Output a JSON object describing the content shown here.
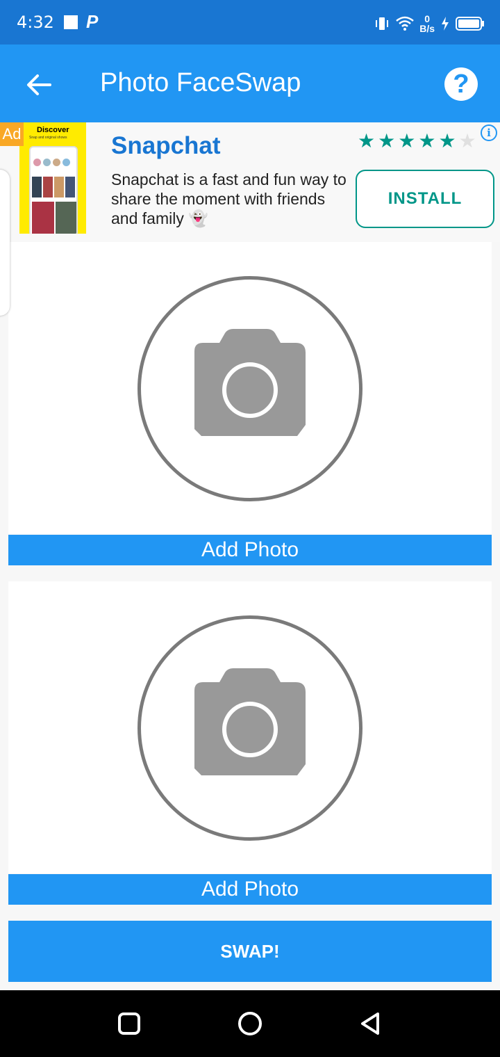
{
  "status_bar": {
    "time": "4:32",
    "net_speed_value": "0",
    "net_speed_unit": "B/s"
  },
  "app_bar": {
    "title": "Photo FaceSwap"
  },
  "ad": {
    "badge": "Ad",
    "image_title": "Discover",
    "image_subtitle": "Snap and original shows",
    "title": "Snapchat",
    "description": "Snapchat is a fast and fun way to share the moment with friends and family 👻",
    "rating_filled_stars": 5,
    "rating_total_stars": 6,
    "install_label": "INSTALL"
  },
  "photo_slots": [
    {
      "button_label": "Add Photo"
    },
    {
      "button_label": "Add Photo"
    }
  ],
  "swap_label": "SWAP!",
  "colors": {
    "primary": "#2196f3",
    "primary_dark": "#1976d2",
    "ad_accent": "#009688",
    "camera_gray": "#999999"
  }
}
